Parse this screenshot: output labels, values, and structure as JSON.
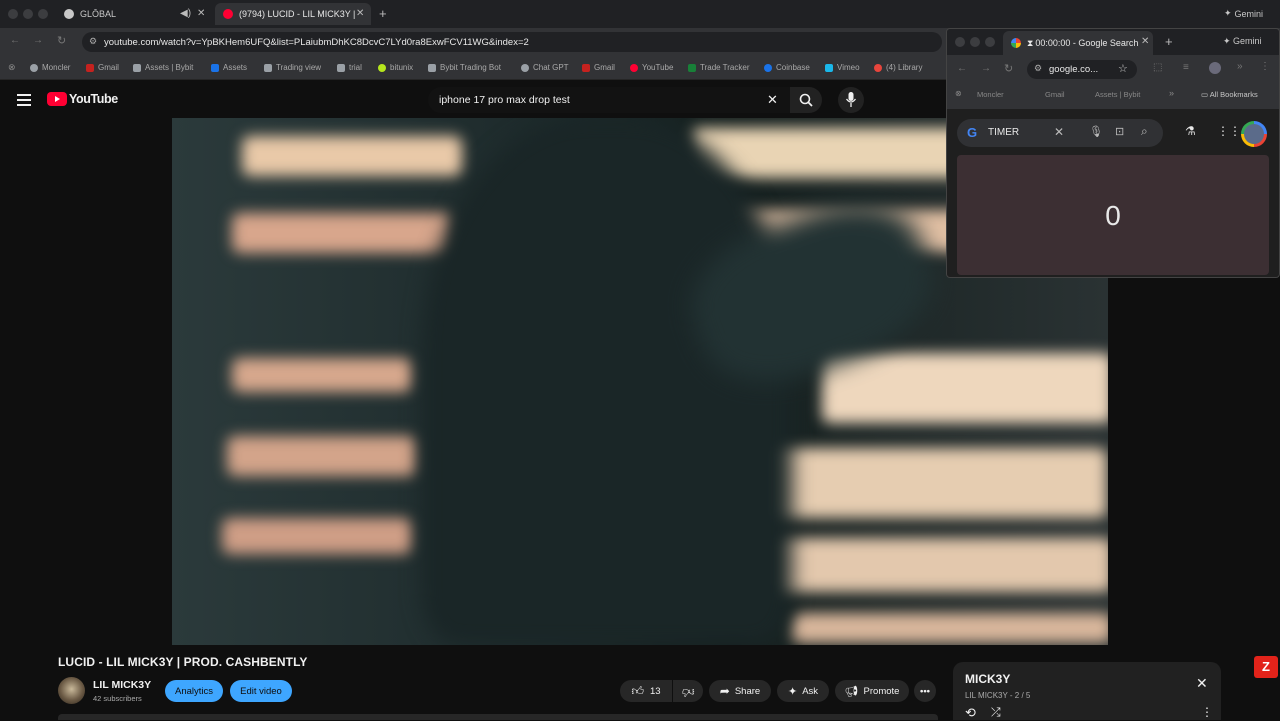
{
  "tabs": [
    {
      "label": "GLŌBAL"
    },
    {
      "label": "(9794) LUCID - LIL MICK3Y |"
    }
  ],
  "address": {
    "url": "youtube.com/watch?v=YpBKHem6UFQ&list=PLaiubmDhKC8DcvC7LYd0ra8ExwFCV11WG&index=2"
  },
  "bookmarks": [
    {
      "label": "Moncler",
      "color": "#9aa0a6"
    },
    {
      "label": "Gmail",
      "color": "#c5221f"
    },
    {
      "label": "Assets | Bybit",
      "color": "#9aa0a6"
    },
    {
      "label": "Assets",
      "color": "#1a73e8"
    },
    {
      "label": "Trading view",
      "color": "#9aa0a6"
    },
    {
      "label": "trial",
      "color": "#9aa0a6"
    },
    {
      "label": "bitunix",
      "color": "#b5e61d"
    },
    {
      "label": "Bybit Trading Bot",
      "color": "#9aa0a6"
    },
    {
      "label": "Chat GPT",
      "color": "#9aa0a6"
    },
    {
      "label": "Gmail",
      "color": "#c5221f"
    },
    {
      "label": "YouTube",
      "color": "#ff0033"
    },
    {
      "label": "Trade Tracker",
      "color": "#188038"
    },
    {
      "label": "Coinbase",
      "color": "#1a73e8"
    },
    {
      "label": "Vimeo",
      "color": "#1ab7ea"
    },
    {
      "label": "(4) Library",
      "color": "#e8453c"
    }
  ],
  "gemini": {
    "label": "Gemini"
  },
  "youtube": {
    "logo": "YouTube",
    "search_value": "iphone 17 pro max drop test"
  },
  "video": {
    "title": "LUCID - LIL MICK3Y | PROD. CASHBENTLY",
    "channel": "LIL MICK3Y",
    "subscribers": "42 subscribers",
    "analytics_label": "Analytics",
    "edit_label": "Edit video",
    "likes": "13",
    "share_label": "Share",
    "ask_label": "Ask",
    "promote_label": "Promote"
  },
  "playlist": {
    "title": "MICK3Y",
    "subtitle": "LIL MICK3Y - 2 / 5"
  },
  "popup": {
    "tab_label": "00:00:00 - Google Search",
    "url": "google.co...",
    "gemini": "Gemini",
    "bookmarks": [
      "Moncler",
      "Gmail",
      "Assets | Bybit"
    ],
    "all_bookmarks": "All Bookmarks",
    "search_value": "TIMER",
    "timer_value": "0"
  },
  "colors": {
    "accent": "#3ea6ff",
    "brand": "#ff0033",
    "timer_bg": "#3c2f33"
  }
}
